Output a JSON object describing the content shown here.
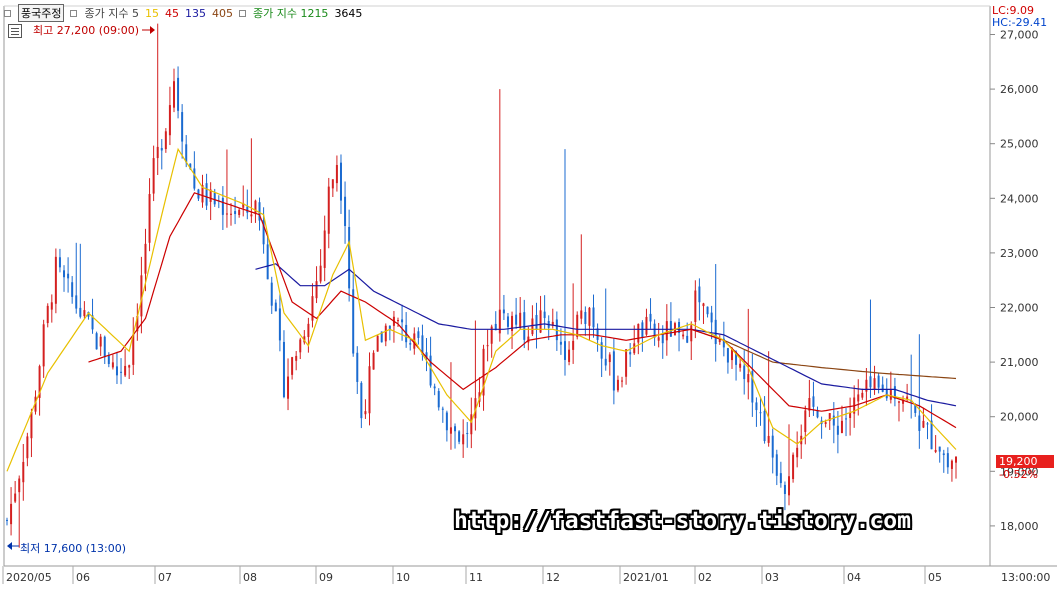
{
  "legend": {
    "title": "풍국주정",
    "ma_label": "종가 지수 5",
    "ma_periods": [
      {
        "label": "15",
        "color": "#e8c000"
      },
      {
        "label": "45",
        "color": "#cc0000"
      },
      {
        "label": "135",
        "color": "#1a1aa0"
      },
      {
        "label": "405",
        "color": "#8b4513"
      }
    ],
    "ma2_label": "종가 지수 1215",
    "ma2_extra": "3645"
  },
  "flags": {
    "lc": "LC:9.09",
    "hc": "HC:-29.41"
  },
  "annotations": {
    "high": "최고 27,200 (09:00)",
    "low": "최저 17,600 (13:00)"
  },
  "current": {
    "price": "19,200",
    "change": "-0.52%"
  },
  "watermark": "http://fastfast-story.tistory.com",
  "chart_data": {
    "type": "candlestick",
    "y_ticks": [
      "27,000",
      "26,000",
      "25,000",
      "24,000",
      "23,000",
      "22,000",
      "21,000",
      "20,000",
      "19,000",
      "18,000"
    ],
    "ylim": [
      17300,
      27200
    ],
    "x_ticks": [
      "2020/05",
      "06",
      "07",
      "08",
      "09",
      "10",
      "11",
      "12",
      "2021/01",
      "02",
      "03",
      "04",
      "05",
      "13:00:00"
    ],
    "price_path": [
      [
        0,
        18100
      ],
      [
        3,
        19000
      ],
      [
        6,
        20000
      ],
      [
        9,
        21500
      ],
      [
        12,
        22700
      ],
      [
        15,
        22300
      ],
      [
        18,
        21900
      ],
      [
        21,
        21500
      ],
      [
        24,
        21200
      ],
      [
        27,
        20800
      ],
      [
        30,
        21100
      ],
      [
        33,
        22500
      ],
      [
        36,
        24500
      ],
      [
        39,
        25400
      ],
      [
        41,
        26200
      ],
      [
        43,
        25200
      ],
      [
        46,
        24200
      ],
      [
        49,
        24000
      ],
      [
        52,
        23900
      ],
      [
        55,
        23800
      ],
      [
        58,
        23700
      ],
      [
        61,
        23900
      ],
      [
        63,
        23300
      ],
      [
        66,
        21700
      ],
      [
        68,
        20600
      ],
      [
        70,
        21000
      ],
      [
        72,
        21400
      ],
      [
        74,
        21900
      ],
      [
        77,
        22800
      ],
      [
        79,
        24100
      ],
      [
        81,
        24700
      ],
      [
        83,
        23700
      ],
      [
        85,
        21200
      ],
      [
        87,
        20000
      ],
      [
        89,
        20700
      ],
      [
        91,
        21300
      ],
      [
        94,
        21800
      ],
      [
        97,
        21600
      ],
      [
        100,
        21300
      ],
      [
        102,
        21100
      ],
      [
        104,
        20800
      ],
      [
        106,
        20300
      ],
      [
        109,
        19800
      ],
      [
        112,
        19600
      ],
      [
        115,
        20100
      ],
      [
        118,
        21500
      ],
      [
        121,
        21900
      ],
      [
        124,
        21800
      ],
      [
        127,
        21600
      ],
      [
        130,
        21700
      ],
      [
        133,
        21800
      ],
      [
        135,
        21400
      ],
      [
        137,
        20900
      ],
      [
        140,
        21700
      ],
      [
        143,
        22000
      ],
      [
        146,
        21300
      ],
      [
        149,
        20700
      ],
      [
        151,
        20800
      ],
      [
        154,
        21500
      ],
      [
        157,
        21600
      ],
      [
        160,
        21400
      ],
      [
        163,
        21600
      ],
      [
        166,
        21300
      ],
      [
        169,
        22200
      ],
      [
        171,
        21900
      ],
      [
        173,
        21600
      ],
      [
        175,
        21300
      ],
      [
        177,
        21200
      ],
      [
        179,
        20900
      ],
      [
        181,
        20600
      ],
      [
        183,
        20500
      ],
      [
        185,
        20000
      ],
      [
        187,
        19500
      ],
      [
        189,
        19100
      ],
      [
        191,
        18800
      ],
      [
        193,
        19500
      ],
      [
        195,
        19800
      ],
      [
        197,
        20100
      ],
      [
        199,
        20200
      ],
      [
        201,
        19900
      ],
      [
        203,
        19800
      ],
      [
        206,
        20000
      ],
      [
        209,
        20300
      ],
      [
        212,
        20500
      ],
      [
        215,
        20400
      ],
      [
        218,
        20500
      ],
      [
        221,
        20300
      ],
      [
        224,
        19900
      ],
      [
        227,
        19600
      ],
      [
        229,
        19500
      ],
      [
        231,
        19100
      ],
      [
        233,
        19300
      ]
    ],
    "ma15": [
      [
        0,
        19000
      ],
      [
        10,
        20800
      ],
      [
        20,
        21900
      ],
      [
        30,
        21200
      ],
      [
        38,
        23700
      ],
      [
        42,
        24900
      ],
      [
        48,
        24200
      ],
      [
        58,
        23900
      ],
      [
        63,
        23700
      ],
      [
        68,
        21900
      ],
      [
        74,
        21300
      ],
      [
        80,
        22600
      ],
      [
        84,
        23200
      ],
      [
        88,
        21400
      ],
      [
        94,
        21600
      ],
      [
        100,
        21400
      ],
      [
        108,
        20400
      ],
      [
        114,
        19900
      ],
      [
        120,
        21200
      ],
      [
        126,
        21600
      ],
      [
        134,
        21600
      ],
      [
        140,
        21500
      ],
      [
        146,
        21300
      ],
      [
        152,
        21200
      ],
      [
        160,
        21500
      ],
      [
        168,
        21700
      ],
      [
        176,
        21400
      ],
      [
        182,
        20900
      ],
      [
        188,
        19800
      ],
      [
        194,
        19500
      ],
      [
        200,
        19900
      ],
      [
        208,
        20100
      ],
      [
        216,
        20400
      ],
      [
        222,
        20300
      ],
      [
        228,
        19800
      ],
      [
        233,
        19400
      ]
    ],
    "ma45": [
      [
        20,
        21000
      ],
      [
        28,
        21200
      ],
      [
        34,
        21800
      ],
      [
        40,
        23300
      ],
      [
        46,
        24100
      ],
      [
        54,
        23900
      ],
      [
        62,
        23700
      ],
      [
        70,
        22100
      ],
      [
        76,
        21800
      ],
      [
        82,
        22300
      ],
      [
        88,
        22100
      ],
      [
        96,
        21700
      ],
      [
        104,
        21000
      ],
      [
        112,
        20500
      ],
      [
        120,
        20900
      ],
      [
        128,
        21400
      ],
      [
        136,
        21500
      ],
      [
        144,
        21500
      ],
      [
        152,
        21400
      ],
      [
        160,
        21500
      ],
      [
        168,
        21600
      ],
      [
        176,
        21400
      ],
      [
        184,
        20800
      ],
      [
        192,
        20200
      ],
      [
        200,
        20100
      ],
      [
        208,
        20200
      ],
      [
        216,
        20400
      ],
      [
        224,
        20200
      ],
      [
        233,
        19800
      ]
    ],
    "ma135": [
      [
        61,
        22700
      ],
      [
        66,
        22800
      ],
      [
        72,
        22400
      ],
      [
        78,
        22400
      ],
      [
        84,
        22700
      ],
      [
        90,
        22300
      ],
      [
        98,
        22000
      ],
      [
        106,
        21700
      ],
      [
        114,
        21600
      ],
      [
        122,
        21600
      ],
      [
        132,
        21700
      ],
      [
        140,
        21600
      ],
      [
        150,
        21600
      ],
      [
        160,
        21600
      ],
      [
        168,
        21600
      ],
      [
        176,
        21500
      ],
      [
        184,
        21200
      ],
      [
        192,
        20900
      ],
      [
        200,
        20600
      ],
      [
        210,
        20500
      ],
      [
        218,
        20500
      ],
      [
        226,
        20300
      ],
      [
        233,
        20200
      ]
    ],
    "ma405": [
      [
        168,
        21600
      ],
      [
        176,
        21400
      ],
      [
        188,
        21000
      ],
      [
        200,
        20900
      ],
      [
        214,
        20800
      ],
      [
        233,
        20700
      ]
    ]
  }
}
